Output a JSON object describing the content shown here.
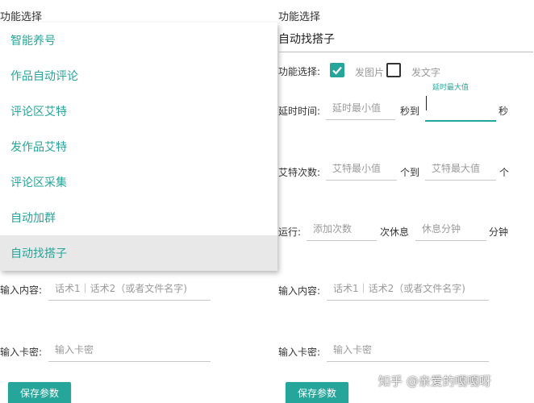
{
  "left": {
    "title": "功能选择",
    "menu_items": [
      "智能养号",
      "作品自动评论",
      "评论区艾特",
      "发作品艾特",
      "评论区采集",
      "自动加群",
      "自动找搭子"
    ],
    "selected_index": 6,
    "content_label": "输入内容:",
    "content_placeholder": "话术1｜话术2（或者文件名字)",
    "card_label": "输入卡密:",
    "card_placeholder": "输入卡密",
    "save_label": "保存参数"
  },
  "right": {
    "title": "功能选择",
    "selected_function": "自动找搭子",
    "func_label": "功能选择:",
    "opt_image": {
      "label": "发图片",
      "checked": true
    },
    "opt_text": {
      "label": "发文字",
      "checked": false
    },
    "delay_label": "延时时间:",
    "delay_min_placeholder": "延时最小值",
    "delay_to": "秒到",
    "delay_max_hint": "延时最大值",
    "delay_unit": "秒",
    "at_label": "艾特次数:",
    "at_min_placeholder": "艾特最小值",
    "at_to": "个到",
    "at_max_placeholder": "艾特最大值",
    "at_unit": "个",
    "run_label": "运行:",
    "run_count_placeholder": "添加次数",
    "run_mid": "次休息",
    "rest_placeholder": "休息分钟",
    "rest_unit": "分钟",
    "content_label": "输入内容:",
    "content_placeholder": "话术1｜话术2（或者文件名字)",
    "card_label": "输入卡密:",
    "card_placeholder": "输入卡密",
    "save_label": "保存参数"
  },
  "watermark": "知乎 @亲爱的嘎嘎呀",
  "colors": {
    "accent": "#26a69a",
    "placeholder": "#9a9a9a",
    "selected_bg": "#e8e8e8"
  }
}
